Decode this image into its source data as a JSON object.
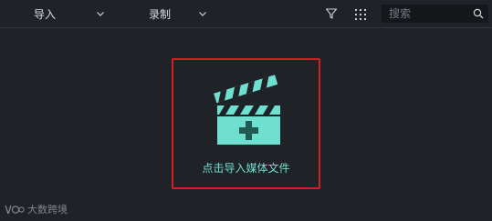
{
  "toolbar": {
    "import_label": "导入",
    "record_label": "录制",
    "search_placeholder": "搜索"
  },
  "dropzone": {
    "label": "点击导入媒体文件",
    "accent_color": "#6fe0cf",
    "highlight_color": "#d71e22"
  },
  "watermark": {
    "text": "大数跨境"
  },
  "icons": [
    "chevron-down-icon",
    "filter-icon",
    "grid-view-icon",
    "search-icon",
    "clapperboard-add-icon"
  ]
}
